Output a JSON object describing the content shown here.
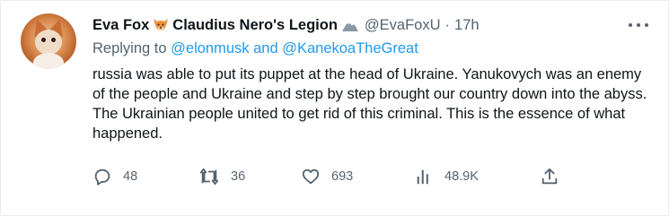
{
  "author": {
    "display_name": "Eva Fox",
    "display_name_suffix": "Claudius Nero's Legion",
    "handle": "@EvaFoxU",
    "separator": "·",
    "time": "17h"
  },
  "reply_to": {
    "prefix": "Replying to ",
    "mentions": "@elonmusk and @KanekoaTheGreat"
  },
  "tweet": {
    "text": "russia was able to put its puppet at the head of Ukraine. Yanukovych was an enemy of the people and Ukraine and step by step brought our country down into the abyss. The Ukrainian people united to get rid of this criminal. This is the essence of what happened."
  },
  "actions": {
    "replies": "48",
    "retweets": "36",
    "likes": "693",
    "views": "48.9K"
  },
  "icons": {
    "avatar": "fox-avatar",
    "name_emoji_1": "fox-face-icon",
    "name_emoji_2": "snow-mountain-icon",
    "more": "more-options-icon",
    "reply": "reply-icon",
    "retweet": "retweet-icon",
    "like": "heart-icon",
    "views": "analytics-icon",
    "share": "share-icon"
  },
  "colors": {
    "text": "#0f1419",
    "secondary": "#536471",
    "link": "#1d9bf0"
  }
}
